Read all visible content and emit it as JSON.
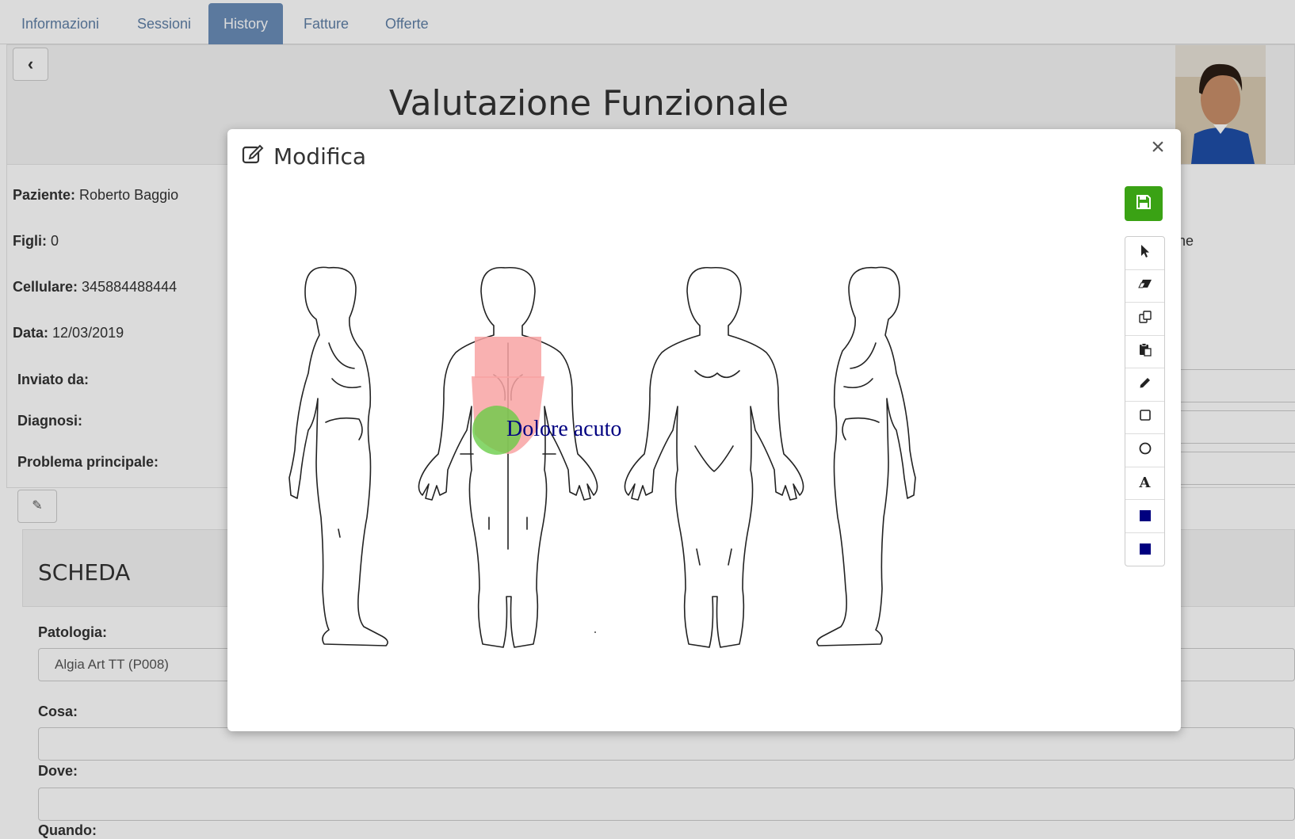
{
  "tabs": [
    {
      "label": "Informazioni",
      "active": false
    },
    {
      "label": "Sessioni",
      "active": false
    },
    {
      "label": "History",
      "active": true
    },
    {
      "label": "Fatture",
      "active": false
    },
    {
      "label": "Offerte",
      "active": false
    }
  ],
  "page": {
    "title": "Valutazione Funzionale"
  },
  "patient": {
    "name_label": "Paziente:",
    "name": "Roberto Baggio",
    "children_label": "Figli:",
    "children": "0",
    "phone_label": "Cellulare:",
    "phone": "345884488444",
    "date_label": "Data:",
    "date": "12/03/2019",
    "sent_by_label": "Inviato da:",
    "diagnosis_label": "Diagnosi:",
    "main_problem_label": "Problema principale:",
    "right_partial_text": "ne"
  },
  "scheda": {
    "title": "SCHEDA",
    "pathology_label": "Patologia:",
    "pathology_value": "Algia Art TT (P008)",
    "what_label": "Cosa:",
    "where_label": "Dove:",
    "when_label": "Quando:"
  },
  "modal": {
    "title": "Modifica",
    "close": "×",
    "annotation_text": "Dolore acuto",
    "annotation_color": "#000080",
    "pink_fill": "#f8a3a3",
    "green_fill": "#66cc44",
    "save_color": "#3aa214"
  },
  "toolbar": {
    "tools": [
      "pointer-icon",
      "eraser-icon",
      "copy-icon",
      "paste-icon",
      "pencil-icon",
      "square-icon",
      "circle-icon",
      "text-icon",
      "stroke-color-swatch",
      "fill-color-swatch"
    ],
    "text_tool_glyph": "A",
    "stroke_color": "#00007f",
    "fill_color": "#00007f"
  }
}
